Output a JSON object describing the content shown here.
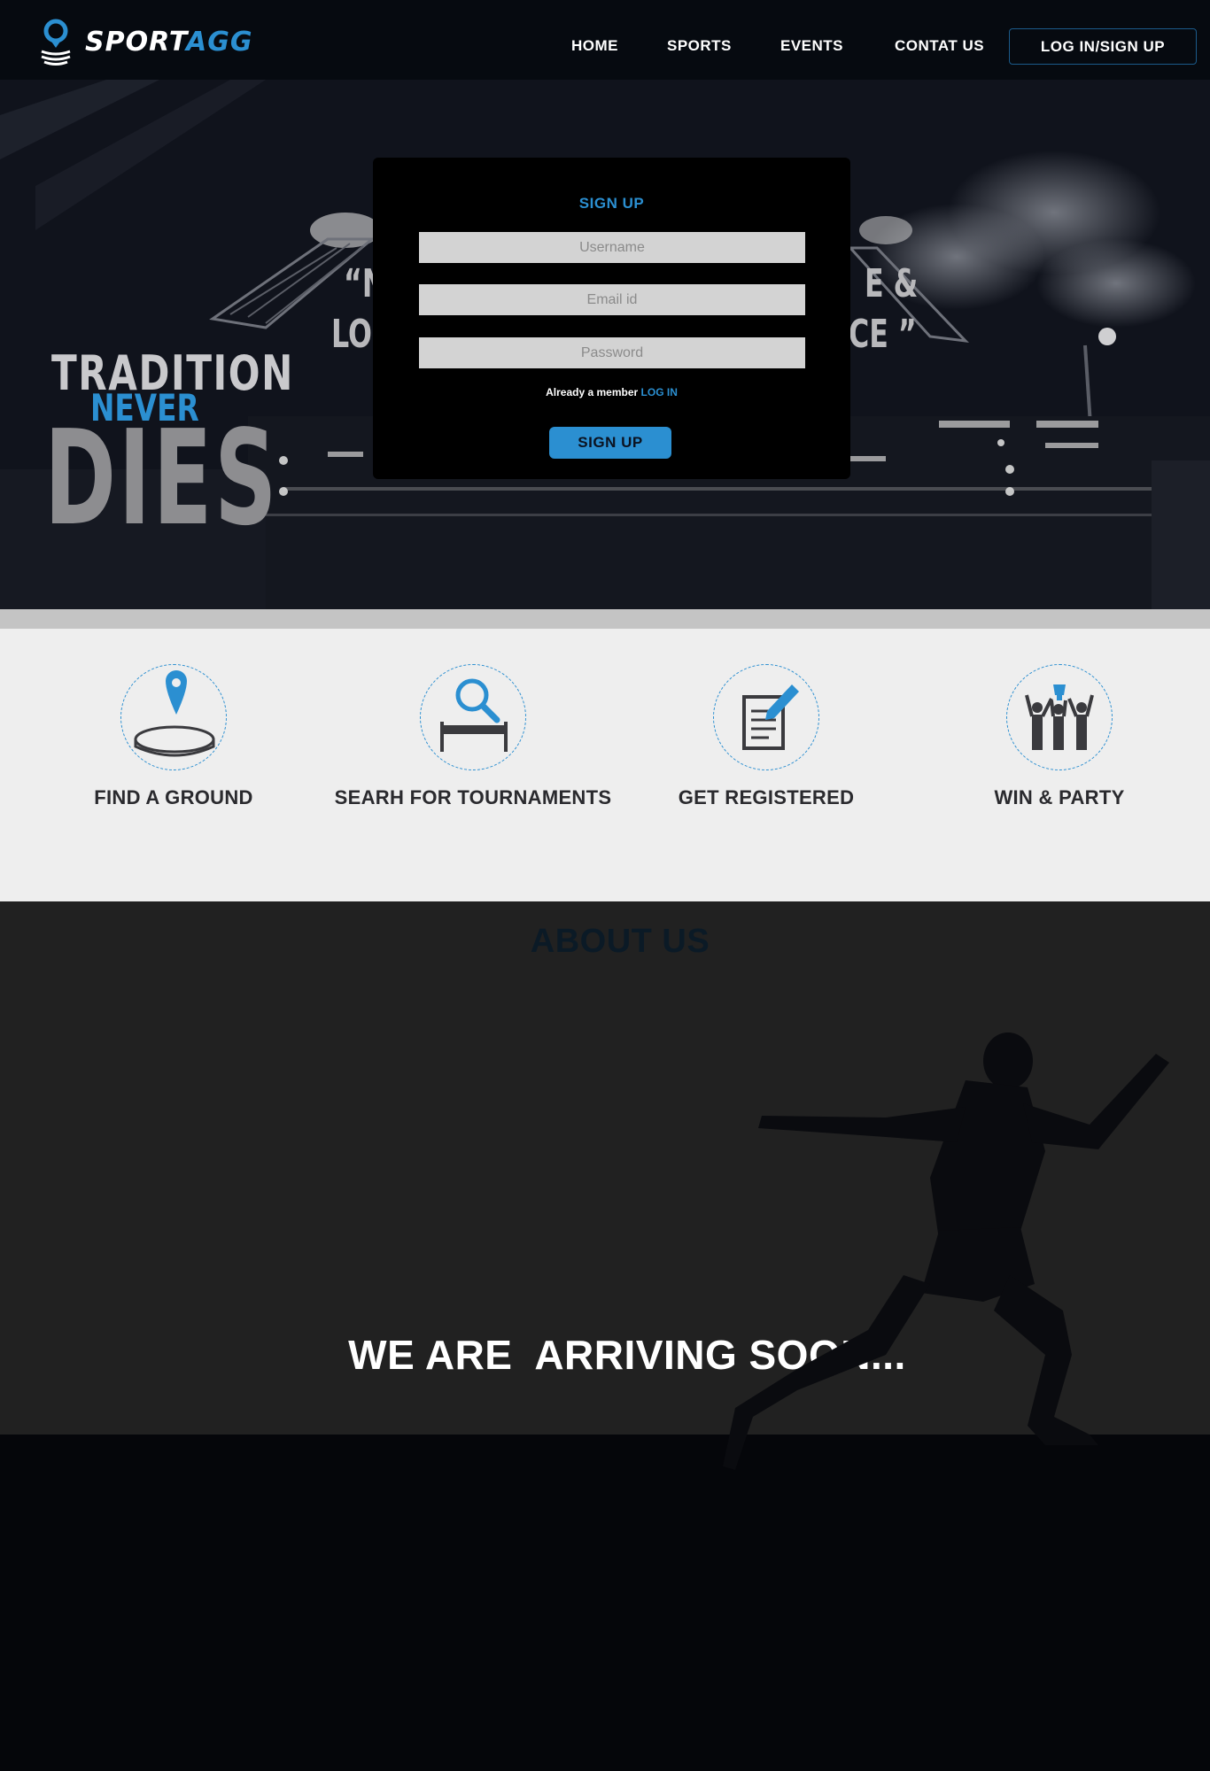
{
  "header": {
    "logo": {
      "text_main": "SPORT",
      "text_accent": "AGG"
    },
    "nav": [
      {
        "label": "HOME"
      },
      {
        "label": "SPORTS"
      },
      {
        "label": "EVENTS"
      },
      {
        "label": "CONTAT US"
      }
    ],
    "login_label": "LOG IN/SIGN UP"
  },
  "hero": {
    "tagline": [
      "TRADITION",
      "NEVER",
      "DIES"
    ],
    "quote_fragments": [
      "“N",
      "E &",
      "LOC",
      "CE ”"
    ]
  },
  "signup_modal": {
    "title": "SIGN UP",
    "username_placeholder": "Username",
    "email_placeholder": "Email id",
    "password_placeholder": "Password",
    "already_text": "Already a member",
    "login_link": "LOG IN",
    "submit_label": "SIGN UP"
  },
  "features": [
    {
      "label": "FIND A GROUND",
      "icon": "map-pin-icon"
    },
    {
      "label": "SEARH FOR TOURNAMENTS",
      "icon": "magnifier-icon"
    },
    {
      "label": "GET REGISTERED",
      "icon": "document-pencil-icon"
    },
    {
      "label": "WIN & PARTY",
      "icon": "celebration-icon"
    }
  ],
  "about": {
    "title": "ABOUT US",
    "arriving": "WE ARE  ARRIVING SOON..."
  },
  "colors": {
    "accent": "#2b8fd1",
    "header_bg": "#060a10",
    "features_bg": "#eeeeee",
    "about_bg": "#212121"
  }
}
